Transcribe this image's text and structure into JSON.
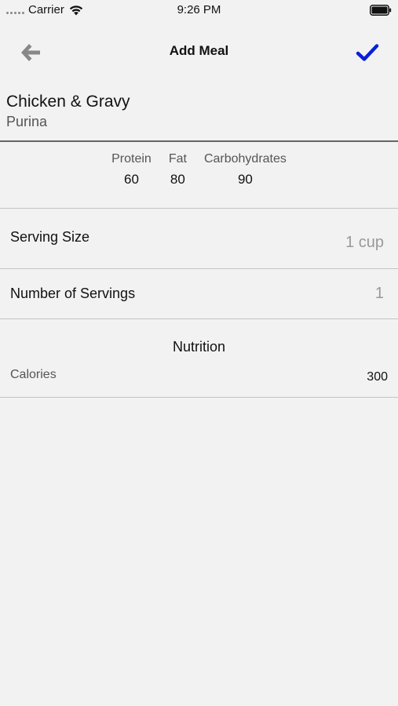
{
  "status_bar": {
    "carrier": "Carrier",
    "time": "9:26 PM",
    "icons": [
      "signal-dots-icon",
      "wifi-icon",
      "battery-icon"
    ]
  },
  "nav": {
    "title": "Add Meal",
    "back_icon": "arrow-left-icon",
    "save_icon": "checkmark-icon",
    "accent_color": "#0a1fd8",
    "back_icon_color": "#888888"
  },
  "food": {
    "name": "Chicken & Gravy",
    "brand": "Purina"
  },
  "macros": [
    {
      "label": "Protein",
      "value": "60"
    },
    {
      "label": "Fat",
      "value": "80"
    },
    {
      "label": "Carbohydrates",
      "value": "90"
    }
  ],
  "serving_size": {
    "label": "Serving Size",
    "value": "1 cup"
  },
  "servings": {
    "label": "Number of Servings",
    "value": "1"
  },
  "nutrition": {
    "title": "Nutrition",
    "calories_label": "Calories",
    "calories_value": "300"
  }
}
